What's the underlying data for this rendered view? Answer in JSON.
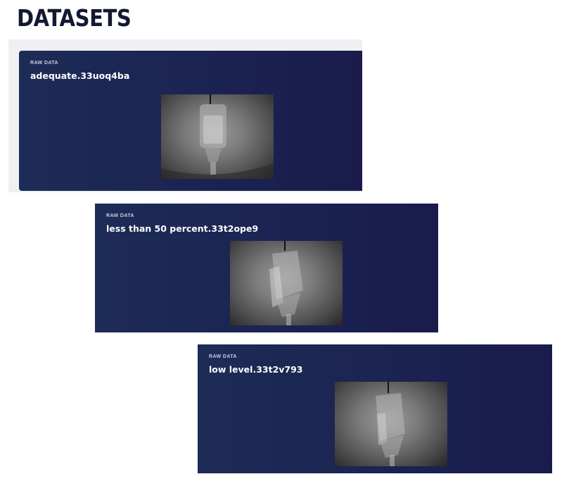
{
  "page": {
    "title": "DATASETS"
  },
  "datasets": [
    {
      "label": "RAW DATA",
      "name": "adequate.33uoq4ba",
      "image": "iv-bag-photo"
    },
    {
      "label": "RAW DATA",
      "name": "less than 50 percent.33t2ope9",
      "image": "iv-bag-photo"
    },
    {
      "label": "RAW DATA",
      "name": "low level.33t2v793",
      "image": "iv-bag-photo"
    }
  ]
}
